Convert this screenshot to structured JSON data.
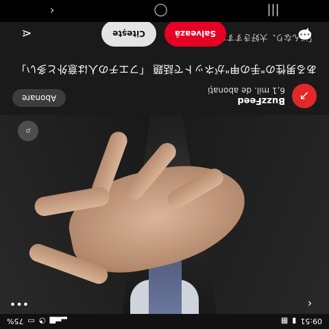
{
  "status": {
    "time": "09:51",
    "battery": "75%",
    "icons": [
      "notification-icon",
      "calendar-icon",
      "signal-icon",
      "wifi-icon",
      "battery-icon"
    ]
  },
  "pin": {
    "channel": {
      "name": "BuzzFeed",
      "subscribers": "6,1 mil. de abonați",
      "avatar_icon": "buzzfeed-arrow-icon",
      "follow_label": "Abonare"
    },
    "title": "ある男性の\"手の甲\"がネットで話題 「フエチの人は意外と多い」",
    "description": "「ほんなり、大好きすすなうすなあ"
  },
  "actions": {
    "read_label": "Citește",
    "save_label": "Salvează",
    "comment_icon": "comment-icon",
    "share_icon": "share-icon"
  },
  "top_controls": {
    "back_icon": "chevron-left-icon",
    "more_icon": "more-dots-icon",
    "lens_icon": "lens-search-icon"
  },
  "nav": {
    "items": [
      "recent-apps-icon",
      "home-icon",
      "back-icon"
    ]
  },
  "colors": {
    "save": "#e60023",
    "avatar": "#e12929",
    "sheet": "#1a1a1a"
  }
}
